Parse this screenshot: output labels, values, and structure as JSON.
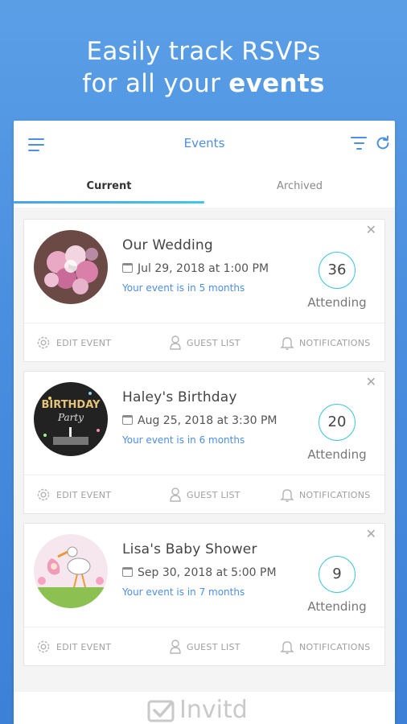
{
  "hero": {
    "line1": "Easily track RSVPs",
    "line2_prefix": "for all your ",
    "line2_strong": "events"
  },
  "header": {
    "title": "Events"
  },
  "tabs": [
    {
      "label": "Current"
    },
    {
      "label": "Archived"
    }
  ],
  "events": [
    {
      "title": "Our Wedding",
      "date": "Jul 29, 2018  at  1:00 PM",
      "eta": "Your event is in 5 months",
      "count": "36",
      "attending": "Attending"
    },
    {
      "title": "Haley's Birthday",
      "date": "Aug 25, 2018  at  3:30 PM",
      "eta": "Your event is in 6 months",
      "count": "20",
      "attending": "Attending"
    },
    {
      "title": "Lisa's Baby Shower",
      "date": "Sep 30, 2018  at  5:00 PM",
      "eta": "Your event is in 7 months",
      "count": "9",
      "attending": "Attending"
    }
  ],
  "actions": {
    "edit": "EDIT EVENT",
    "guests": "GUEST LIST",
    "notifications": "NOTIFICATIONS"
  },
  "footer": {
    "logo_text": "Invitd"
  },
  "colors": {
    "accent": "#4d8fe5",
    "teal": "#3fc7d8",
    "background": "#4b8fe0"
  }
}
